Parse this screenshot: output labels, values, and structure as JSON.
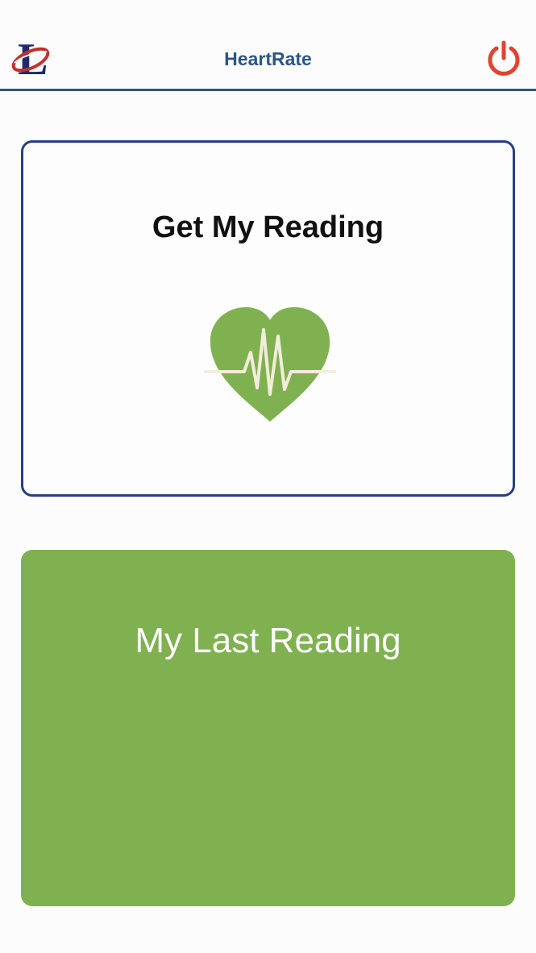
{
  "header": {
    "title": "HeartRate",
    "logo_icon": "lamar-l-logo-icon",
    "power_icon": "power-icon"
  },
  "get_reading_card": {
    "title": "Get My Reading",
    "icon": "heart-pulse-icon"
  },
  "last_reading_card": {
    "title": "My Last Reading",
    "value": ""
  },
  "colors": {
    "header_text": "#2b5587",
    "card_border": "#253f82",
    "accent_green": "#80b151",
    "power_red": "#e0432f"
  }
}
